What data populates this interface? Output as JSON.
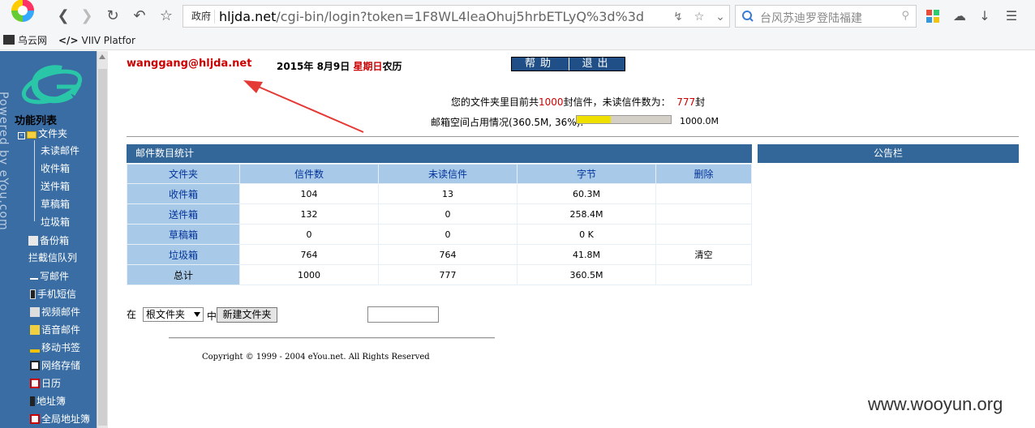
{
  "browser": {
    "url_tag": "政府",
    "url_host": "hljda.net",
    "url_rest": "/cgi-bin/login?token=1F8WL4leaOhuj5hrbETLyQ%3d%3d",
    "search_placeholder": "台风苏迪罗登陆福建",
    "bookmarks": [
      "乌云网",
      "VIIV Platfor"
    ]
  },
  "header": {
    "user": "wanggang@hljda.net",
    "date_prefix": "2015年  8月9日  ",
    "weekday": "星期日",
    "date_suffix": "农历",
    "help_label": "帮助",
    "logout_label": "退出"
  },
  "sidebar": {
    "powered": "Powered by eYou.com",
    "title": "功能列表",
    "folder_root": "文件夹",
    "folders": [
      "未读邮件",
      "收件箱",
      "送件箱",
      "草稿箱",
      "垃圾箱"
    ],
    "items": [
      "备份箱",
      "拦截信队列",
      "写邮件",
      "手机短信",
      "视频邮件",
      "语音邮件",
      "移动书签",
      "网络存储",
      "日历",
      "地址簿",
      "全局地址簿"
    ]
  },
  "summary": {
    "text1": "您的文件夹里目前共",
    "total": "1000",
    "text2": "封信件，未读信件数为：",
    "unread": "777",
    "text3": "封",
    "space_label": "邮箱空间占用情况(360.5M, 36%):",
    "space_fraction": 0.36,
    "space_total": "1000.0M"
  },
  "stats": {
    "title": "邮件数目统计",
    "columns": [
      "文件夹",
      "信件数",
      "未读信件",
      "字节",
      "删除"
    ],
    "rows": [
      {
        "name": "收件箱",
        "count": "104",
        "unread": "13",
        "bytes": "60.3M",
        "action": ""
      },
      {
        "name": "送件箱",
        "count": "132",
        "unread": "0",
        "bytes": "258.4M",
        "action": ""
      },
      {
        "name": "草稿箱",
        "count": "0",
        "unread": "0",
        "bytes": "0 K",
        "action": ""
      },
      {
        "name": "垃圾箱",
        "count": "764",
        "unread": "764",
        "bytes": "41.8M",
        "action": "清空"
      },
      {
        "name": "总计",
        "count": "1000",
        "unread": "777",
        "bytes": "360.5M",
        "action": ""
      }
    ]
  },
  "notice": {
    "title": "公告栏"
  },
  "folder_form": {
    "prefix": "在",
    "select_value": "根文件夹",
    "middle": "中",
    "button": "新建文件夹"
  },
  "footer": {
    "copyright": "Copyright © 1999 - 2004 eYou.net. All Rights Reserved",
    "watermark": "www.wooyun.org"
  },
  "colors": {
    "header_blue": "#336699",
    "cell_blue": "#a9c9e8",
    "accent_red": "#cc0000"
  }
}
